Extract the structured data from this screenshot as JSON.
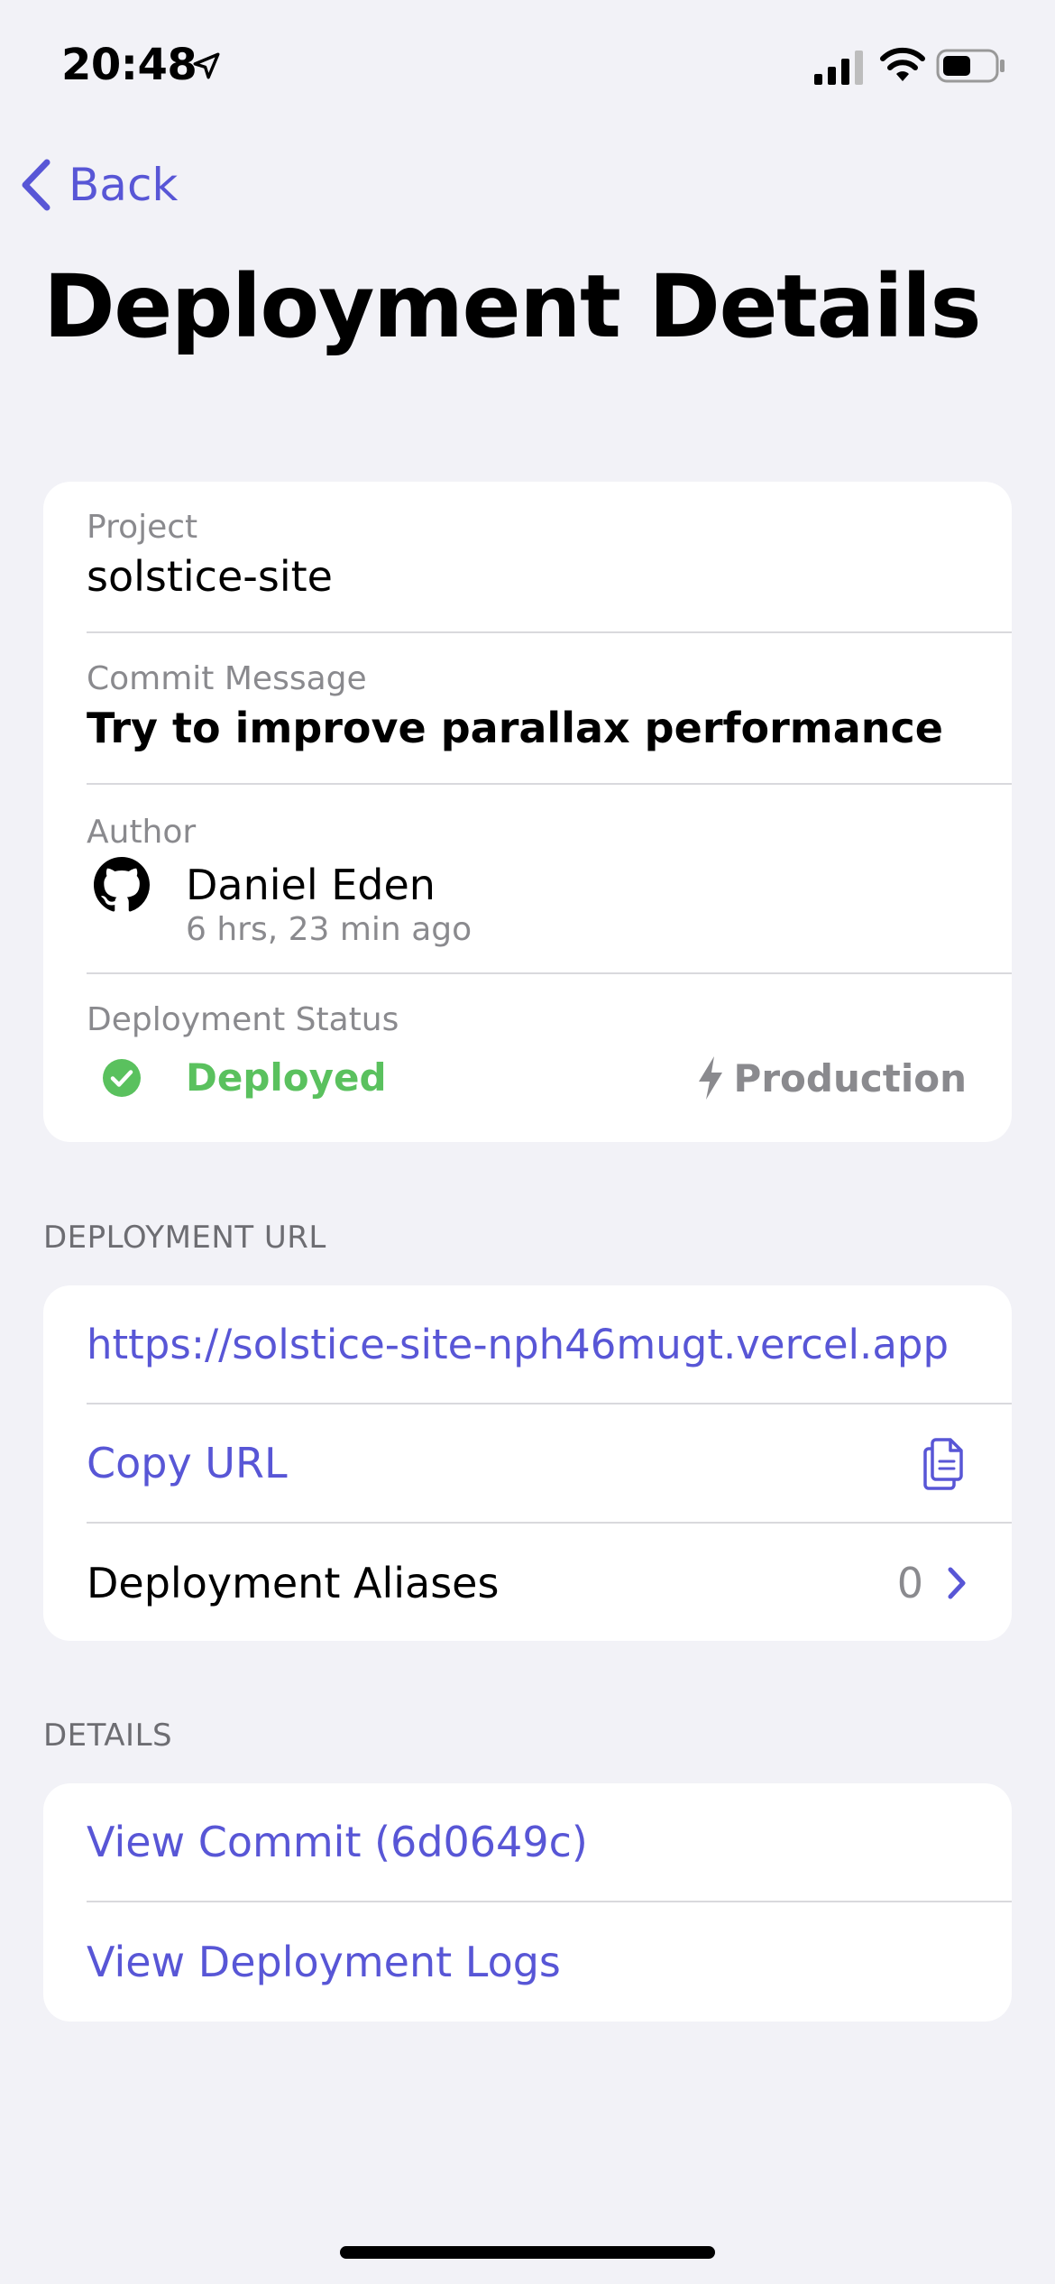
{
  "status_bar": {
    "time": "20:48"
  },
  "nav": {
    "back_label": "Back",
    "title": "Deployment Details"
  },
  "info": {
    "project_label": "Project",
    "project_value": "solstice-site",
    "commit_label": "Commit Message",
    "commit_value": "Try to improve parallax performance",
    "author_label": "Author",
    "author_name": "Daniel Eden",
    "author_time": "6 hrs, 23 min ago",
    "status_label": "Deployment Status",
    "status_value": "Deployed",
    "environment": "Production"
  },
  "url_section": {
    "header": "DEPLOYMENT URL",
    "url": "https://solstice-site-nph46mugt.vercel.app",
    "copy_label": "Copy URL",
    "aliases_label": "Deployment Aliases",
    "aliases_count": "0"
  },
  "details_section": {
    "header": "DETAILS",
    "view_commit": "View Commit (6d0649c)",
    "view_logs": "View Deployment Logs"
  },
  "colors": {
    "accent": "#5856d6",
    "success": "#5ac15e",
    "background": "#f2f2f7",
    "secondary_text": "#8a8a8e"
  },
  "icons": {
    "back": "chevron-left-icon",
    "location": "location-arrow-icon",
    "author": "github-icon",
    "status": "checkmark-circle-icon",
    "environment": "bolt-icon",
    "copy": "copy-icon",
    "disclosure": "chevron-right-icon"
  }
}
